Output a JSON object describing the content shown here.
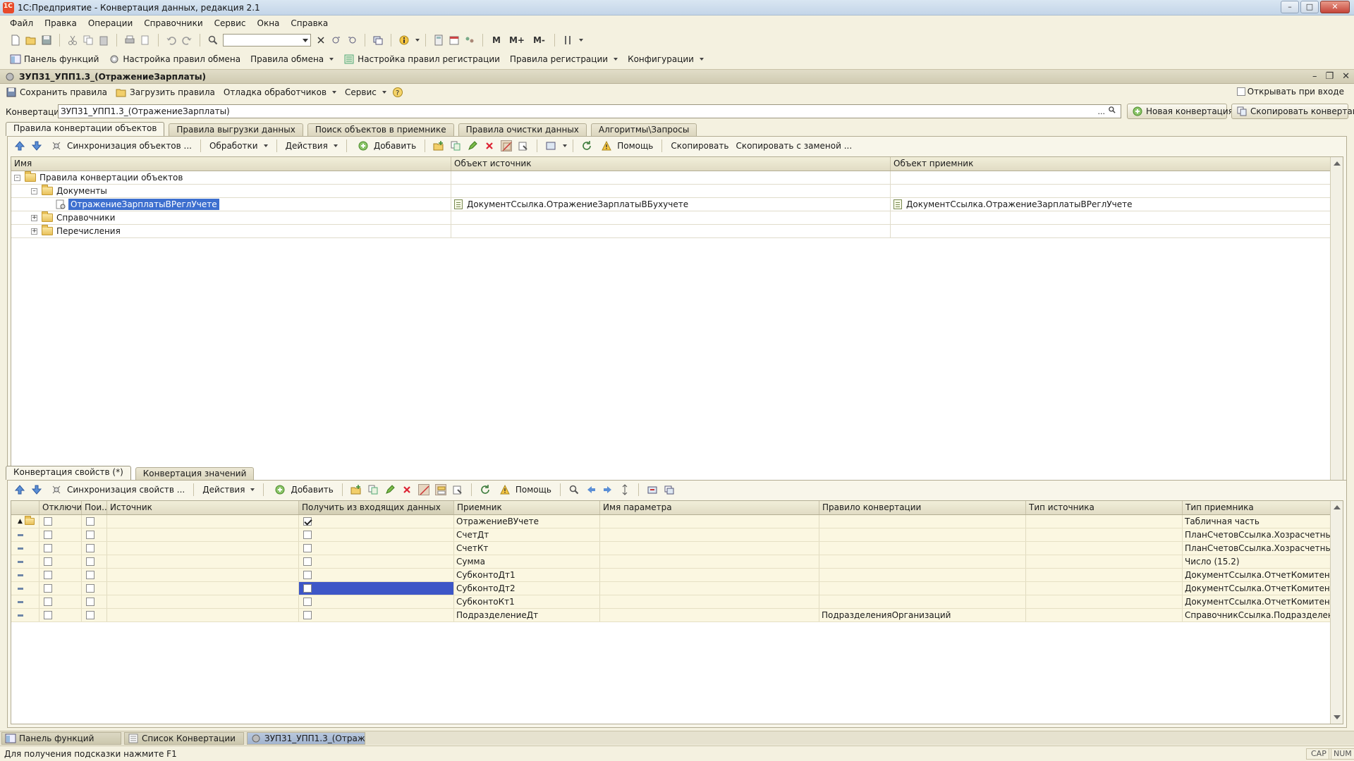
{
  "window": {
    "title": "1С:Предприятие - Конвертация данных, редакция 2.1"
  },
  "menu": [
    "Файл",
    "Правка",
    "Операции",
    "Справочники",
    "Сервис",
    "Окна",
    "Справка"
  ],
  "toolbar1": {
    "m_buttons": [
      "M",
      "M+",
      "M-"
    ]
  },
  "toolbar2": {
    "items": [
      "Панель функций",
      "Настройка правил обмена",
      "Правила обмена",
      "Настройка правил регистрации",
      "Правила регистрации",
      "Конфигурации"
    ]
  },
  "doc": {
    "title": "ЗУП31_УПП1.3_(ОтражениеЗарплаты)",
    "save_rules": "Сохранить правила",
    "load_rules": "Загрузить правила",
    "debug_handlers": "Отладка обработчиков",
    "service": "Сервис",
    "open_on_enter": "Открывать при входе",
    "conversion_label": "Конвертация:",
    "conversion_value": "ЗУП31_УПП1.3_(ОтражениеЗарплаты)",
    "new_conversion": "Новая конвертация ...",
    "copy_conversion": "Скопировать конвертацию"
  },
  "top_tabs": [
    "Правила конвертации объектов",
    "Правила выгрузки данных",
    "Поиск объектов в приемнике",
    "Правила очистки данных",
    "Алгоритмы\\Запросы"
  ],
  "top_tools": {
    "sync": "Синхронизация объектов ...",
    "handlers": "Обработки",
    "actions": "Действия",
    "add": "Добавить",
    "help": "Помощь",
    "copy": "Скопировать",
    "copy_replace": "Скопировать с заменой ..."
  },
  "tree": {
    "columns": [
      "Имя",
      "Объект источник",
      "Объект приемник"
    ],
    "root": "Правила конвертации объектов",
    "documents": "Документы",
    "rule": {
      "name": "ОтражениеЗарплатыВРеглУчете",
      "source": "ДокументСсылка.ОтражениеЗарплатыВБухучете",
      "target": "ДокументСсылка.ОтражениеЗарплатыВРеглУчете"
    },
    "catalogs": "Справочники",
    "enums": "Перечисления"
  },
  "bottom_tabs": [
    "Конвертация свойств (*)",
    "Конвертация значений"
  ],
  "bottom_tools": {
    "sync": "Синхронизация свойств ...",
    "actions": "Действия",
    "add": "Добавить",
    "help": "Помощь"
  },
  "props": {
    "columns": [
      "Отключи...",
      "Пои...",
      "Источник",
      "Получить из входящих данных",
      "Приемник",
      "Имя параметра",
      "Правило конвертации",
      "Тип источника",
      "Тип приемника"
    ],
    "rows": [
      {
        "disabled": false,
        "search": false,
        "source": "",
        "from_incoming": true,
        "target": "ОтражениеВУчете",
        "param": "",
        "rule": "",
        "src_type": "",
        "dst_type": "Табличная часть"
      },
      {
        "disabled": false,
        "search": false,
        "source": "",
        "from_incoming": false,
        "target": "СчетДт",
        "param": "",
        "rule": "",
        "src_type": "",
        "dst_type": "ПланСчетовСсылка.Хозрасчетный"
      },
      {
        "disabled": false,
        "search": false,
        "source": "",
        "from_incoming": false,
        "target": "СчетКт",
        "param": "",
        "rule": "",
        "src_type": "",
        "dst_type": "ПланСчетовСсылка.Хозрасчетный"
      },
      {
        "disabled": false,
        "search": false,
        "source": "",
        "from_incoming": false,
        "target": "Сумма",
        "param": "",
        "rule": "",
        "src_type": "",
        "dst_type": "Число (15.2)"
      },
      {
        "disabled": false,
        "search": false,
        "source": "",
        "from_incoming": false,
        "target": "СубконтоДт1",
        "param": "",
        "rule": "",
        "src_type": "",
        "dst_type": "ДокументСсылка.ОтчетКомитентуО..."
      },
      {
        "disabled": false,
        "search": false,
        "source": "",
        "from_incoming": false,
        "target": "СубконтоДт2",
        "param": "",
        "rule": "",
        "src_type": "",
        "dst_type": "ДокументСсылка.ОтчетКомитентуО..."
      },
      {
        "disabled": false,
        "search": false,
        "source": "",
        "from_incoming": false,
        "target": "СубконтоКт1",
        "param": "",
        "rule": "",
        "src_type": "",
        "dst_type": "ДокументСсылка.ОтчетКомитентуО..."
      },
      {
        "disabled": false,
        "search": false,
        "source": "",
        "from_incoming": false,
        "target": "ПодразделениеДт",
        "param": "",
        "rule": "ПодразделенияОрганизаций",
        "src_type": "",
        "dst_type": "СправочникСсылка.ПодразделенияО..."
      }
    ]
  },
  "taskbar": [
    "Панель функций",
    "Список Конвертации",
    "ЗУП31_УПП1.3_(Отражени..."
  ],
  "status": {
    "hint": "Для получения подсказки нажмите F1",
    "cap": "CAP",
    "num": "NUM"
  },
  "colors": {
    "selection": "#3d6fcf",
    "panel_bg": "#f4f1e0",
    "row_yellow": "#fbf7e1"
  }
}
